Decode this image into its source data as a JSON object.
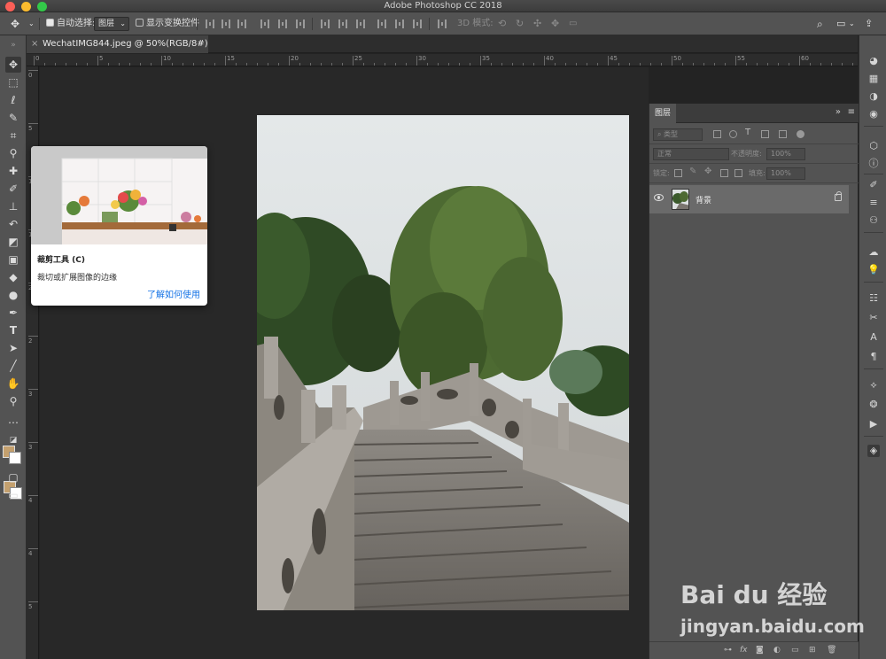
{
  "window": {
    "title": "Adobe Photoshop CC 2018"
  },
  "options_bar": {
    "auto_select_label": "自动选择:",
    "auto_select_checked": true,
    "auto_select_target": "图层",
    "show_transform_label": "显示变换控件",
    "show_transform_checked": false,
    "mode_3d_label": "3D 模式:"
  },
  "document": {
    "tab_title": "WechatIMG844.jpeg @ 50%(RGB/8#)"
  },
  "ruler": {
    "top_numbers": [
      "0",
      "5",
      "10",
      "15",
      "20",
      "25",
      "30",
      "35",
      "40",
      "45",
      "50",
      "55",
      "60"
    ],
    "left_numbers": [
      "0",
      "5",
      "1",
      "1",
      "2",
      "2",
      "3",
      "3",
      "4",
      "4",
      "5"
    ]
  },
  "tooltip": {
    "title": "裁剪工具 (C)",
    "description": "裁切或扩展图像的边缘",
    "link": "了解如何使用"
  },
  "layers_panel": {
    "tab_label": "图层",
    "filter_kind": "类型",
    "blend_mode": "正常",
    "opacity_label": "不透明度:",
    "opacity_value": "100%",
    "lock_label": "锁定:",
    "fill_label": "填充:",
    "fill_value": "100%",
    "layers": [
      {
        "name": "背景",
        "visible": true,
        "locked": true
      }
    ]
  },
  "colors": {
    "foreground": "#c4a06e",
    "background": "#ffffff",
    "link": "#1473e6"
  },
  "watermark": {
    "brand": "Bai du 经验",
    "url": "jingyan.baidu.com"
  }
}
